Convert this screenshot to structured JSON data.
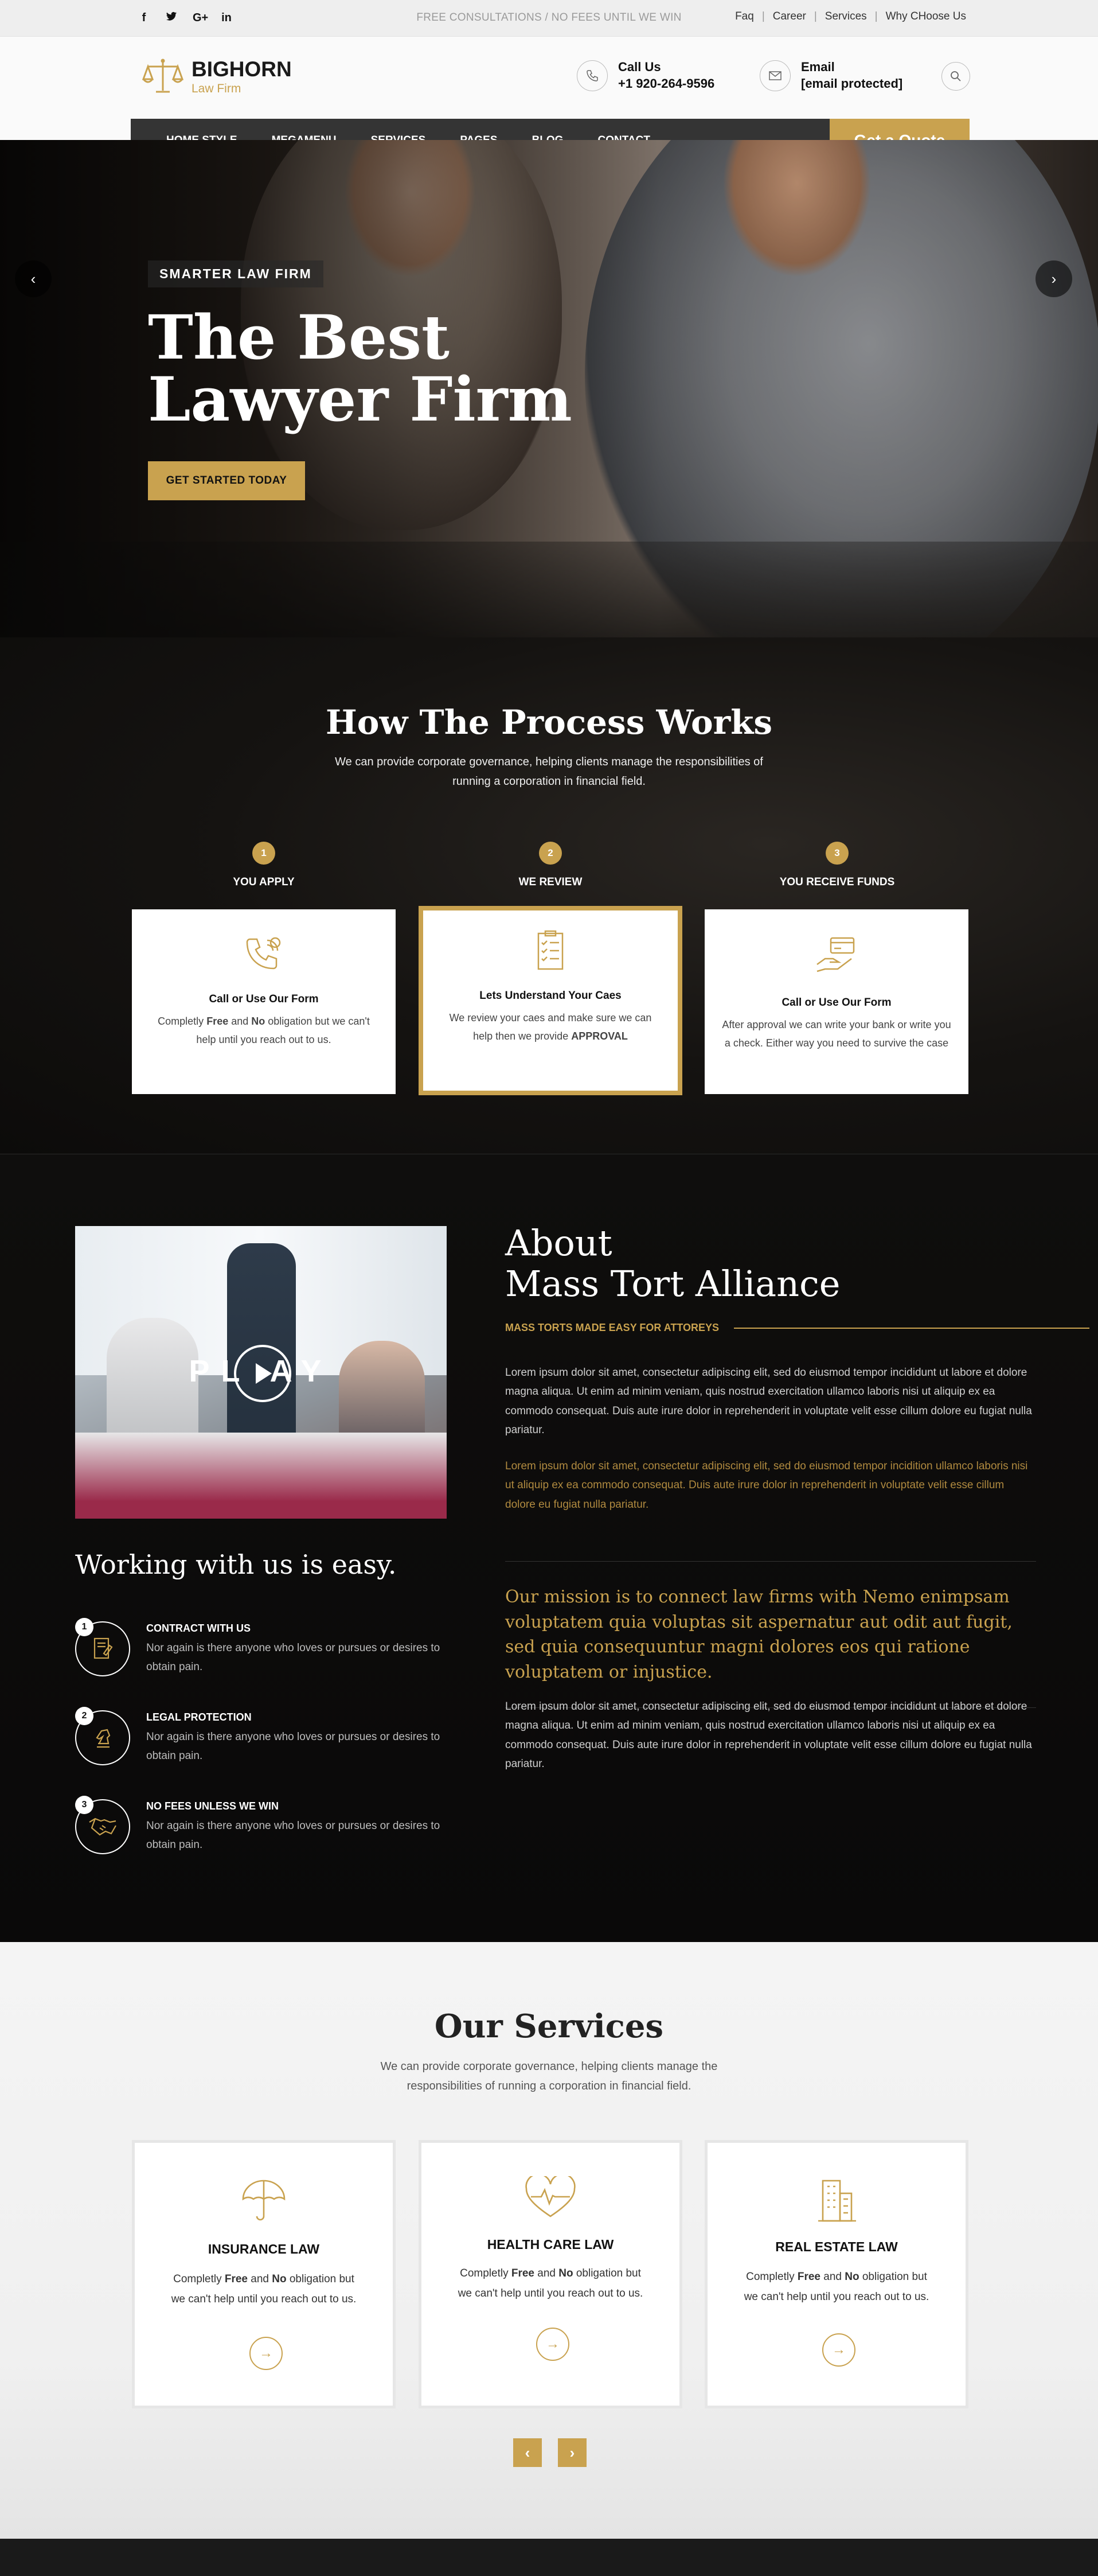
{
  "topbar": {
    "social_icons": [
      "facebook-icon",
      "twitter-icon",
      "google-plus-icon",
      "linkedin-icon"
    ],
    "social_glyphs": [
      "f",
      "t",
      "G+",
      "in"
    ],
    "notice": "FREE CONSULTATIONS / NO FEES UNTIL WE WIN",
    "links": [
      "Faq",
      "Career",
      "Services",
      "Why CHoose Us"
    ]
  },
  "header": {
    "logo_name": "BIGHORN",
    "logo_sub": "Law Firm",
    "call_label": "Call Us",
    "call_value": "+1 920-264-9596",
    "email_label": "Email",
    "email_value": "[email protected]"
  },
  "nav": {
    "items": [
      "HOME STYLE",
      "MEGAMENU",
      "SERVICES",
      "PAGES",
      "BLOG",
      "CONTACT"
    ],
    "quote": "Get a Quote"
  },
  "hero": {
    "tag": "SMARTER LAW FIRM",
    "title": "The Best Lawyer Firm",
    "cta": "GET STARTED TODAY",
    "prev": "‹",
    "next": "›"
  },
  "process": {
    "title": "How The Process Works",
    "desc": "We can provide corporate governance, helping clients manage the responsibilities of running a corporation in financial field.",
    "steps": [
      {
        "num": "1",
        "label": "YOU APPLY",
        "title": "Call or Use Our Form",
        "pre": "Completly ",
        "b1": "Free",
        "mid": " and ",
        "b2": "No",
        "post": " obligation but we can't help until you reach out to us."
      },
      {
        "num": "2",
        "label": "WE REVIEW",
        "title": "Lets Understand Your Caes",
        "pre": "We review your caes and make sure we can help then we provide ",
        "b1": "APPROVAL",
        "mid": "",
        "b2": "",
        "post": ""
      },
      {
        "num": "3",
        "label": "YOU RECEIVE FUNDS",
        "title": "Call or Use Our Form",
        "pre": "After approval we can write your bank or write you a check. Either way you need to survive the case",
        "b1": "",
        "mid": "",
        "b2": "",
        "post": ""
      }
    ]
  },
  "about": {
    "play_text": "PL   AY",
    "title_line1": "About",
    "title_line2": "Mass Tort Alliance",
    "subtitle": "MASS TORTS MADE EASY FOR ATTOREYS",
    "para1": "Lorem ipsum dolor sit amet, consectetur adipiscing elit, sed do eiusmod tempor incididunt ut labore et dolore magna aliqua. Ut enim ad minim veniam, quis nostrud exercitation ullamco laboris nisi ut aliquip ex ea commodo consequat. Duis aute irure dolor in reprehenderit in voluptate velit esse cillum dolore eu fugiat nulla pariatur.",
    "para2": "Lorem ipsum dolor sit amet, consectetur adipiscing elit, sed do eiusmod tempor incidition ullamco laboris nisi ut aliquip ex ea commodo consequat. Duis aute irure dolor in reprehenderit in voluptate velit esse cillum dolore eu fugiat nulla pariatur.",
    "mission": "Our mission is to connect law firms with Nemo enimpsam voluptatem quia voluptas sit aspernatur aut odit aut fugit, sed quia consequuntur magni dolores eos qui ratione voluptatem or injustice.",
    "para3": "Lorem ipsum dolor sit amet, consectetur adipiscing elit, sed do eiusmod tempor incididunt ut labore et dolore magna aliqua. Ut enim ad minim veniam, quis nostrud exercitation ullamco laboris nisi ut aliquip ex ea commodo consequat. Duis aute irure dolor in reprehenderit in voluptate velit esse cillum dolore eu fugiat nulla pariatur.",
    "work_title": "Working with us is easy.",
    "work_items": [
      {
        "num": "1",
        "title": "CONTRACT WITH US",
        "desc": "Nor again is there anyone who loves or pursues or desires to obtain pain."
      },
      {
        "num": "2",
        "title": "LEGAL PROTECTION",
        "desc": "Nor again is there anyone who loves or pursues or desires to obtain pain."
      },
      {
        "num": "3",
        "title": "NO FEES UNLESS WE WIN",
        "desc": "Nor again is there anyone who loves or pursues or desires to obtain pain."
      }
    ]
  },
  "services": {
    "title": "Our Services",
    "desc": "We can provide corporate governance, helping clients manage the responsibilities of running a corporation in financial field.",
    "cards": [
      {
        "title": "INSURANCE LAW",
        "pre": "Completly ",
        "b1": "Free",
        "mid": " and ",
        "b2": "No",
        "post": " obligation but we can't help until you reach out to us."
      },
      {
        "title": "HEALTH CARE LAW",
        "pre": "Completly ",
        "b1": "Free",
        "mid": " and ",
        "b2": "No",
        "post": " obligation but we can't help until you reach out to us."
      },
      {
        "title": "REAL ESTATE LAW",
        "pre": "Completly ",
        "b1": "Free",
        "mid": " and ",
        "b2": "No",
        "post": " obligation but we can't help until you reach out to us."
      }
    ],
    "arrow": "→",
    "prev": "‹",
    "next": "›"
  },
  "colors": {
    "accent": "#c9a24f",
    "dark": "#0c0b0a",
    "nav": "#343434"
  }
}
